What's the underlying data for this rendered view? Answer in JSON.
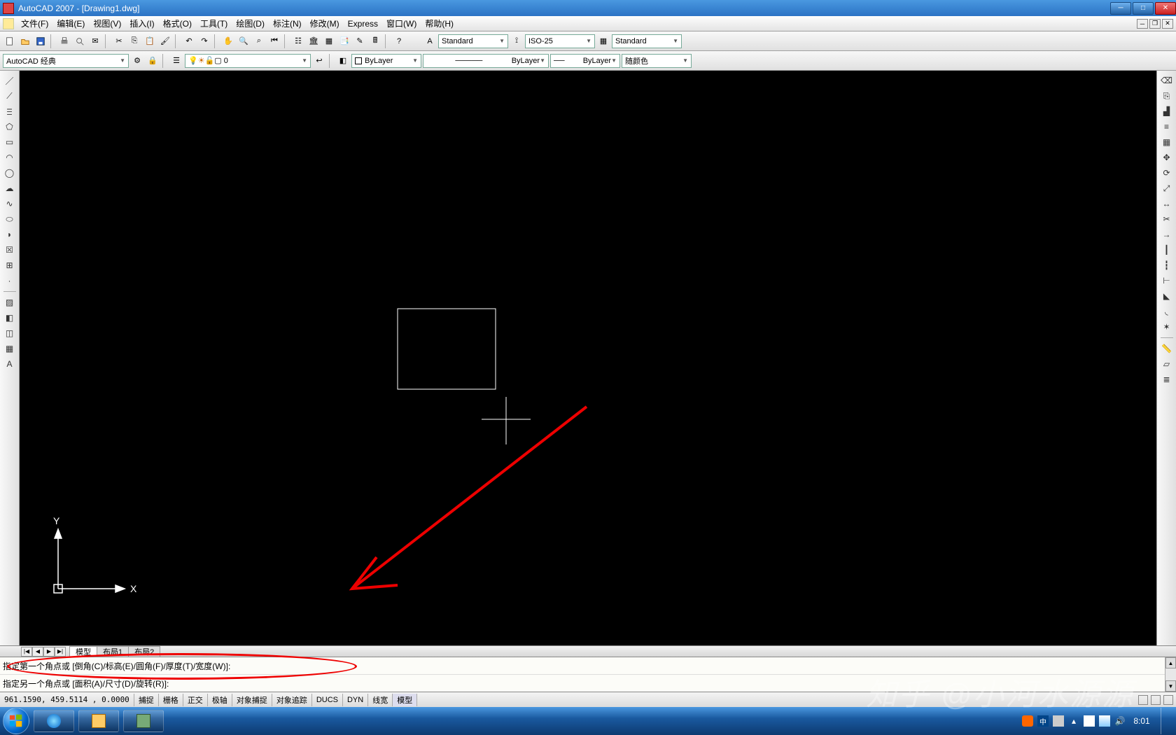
{
  "title": "AutoCAD 2007 - [Drawing1.dwg]",
  "menus": [
    "文件(F)",
    "编辑(E)",
    "视图(V)",
    "插入(I)",
    "格式(O)",
    "工具(T)",
    "绘图(D)",
    "标注(N)",
    "修改(M)",
    "Express",
    "窗口(W)",
    "帮助(H)"
  ],
  "toolbar1": {
    "text_style": "Standard",
    "dim_style": "ISO-25",
    "table_style": "Standard"
  },
  "toolbar2": {
    "workspace": "AutoCAD 经典",
    "layer": "0",
    "layer_line": "ByLayer",
    "lineweight": "ByLayer",
    "color": "随颜色"
  },
  "tabs": {
    "navs": [
      "|◀",
      "◀",
      "▶",
      "▶|"
    ],
    "items": [
      "模型",
      "布局1",
      "布局2"
    ]
  },
  "command": {
    "line1": "指定第一个角点或 [倒角(C)/标高(E)/圆角(F)/厚度(T)/宽度(W)]:",
    "line2": "指定另一个角点或 [面积(A)/尺寸(D)/旋转(R)]:"
  },
  "status": {
    "coords": "961.1590,  459.5114 ,  0.0000",
    "toggles": [
      "捕捉",
      "栅格",
      "正交",
      "极轴",
      "对象捕捉",
      "对象追踪",
      "DUCS",
      "DYN",
      "线宽",
      "模型"
    ]
  },
  "systray": {
    "clock": "8:01",
    "ime": "中"
  },
  "watermark": "知乎 @小河水源源",
  "icons": {
    "line": "line",
    "pline": "construction-line",
    "polyline": "polyline",
    "polygon": "polygon",
    "rect": "rectangle",
    "arc": "arc",
    "circle": "circle",
    "revcloud": "revision-cloud",
    "spline": "spline",
    "ellipse": "ellipse",
    "ellipse_arc": "ellipse-arc",
    "insert": "insert-block",
    "make": "make-block",
    "point": "point",
    "hatch": "hatch",
    "gradient": "gradient",
    "region": "region",
    "table": "table",
    "mtext": "multiline-text",
    "erase": "erase",
    "copy": "copy",
    "mirror": "mirror",
    "offset": "offset",
    "array": "array",
    "move": "move",
    "rotate": "rotate",
    "scale": "scale",
    "stretch": "stretch",
    "trim": "trim",
    "extend": "extend",
    "break_pt": "break-at-point",
    "break": "break",
    "join": "join",
    "chamfer": "chamfer",
    "fillet": "fillet",
    "explode": "explode"
  }
}
